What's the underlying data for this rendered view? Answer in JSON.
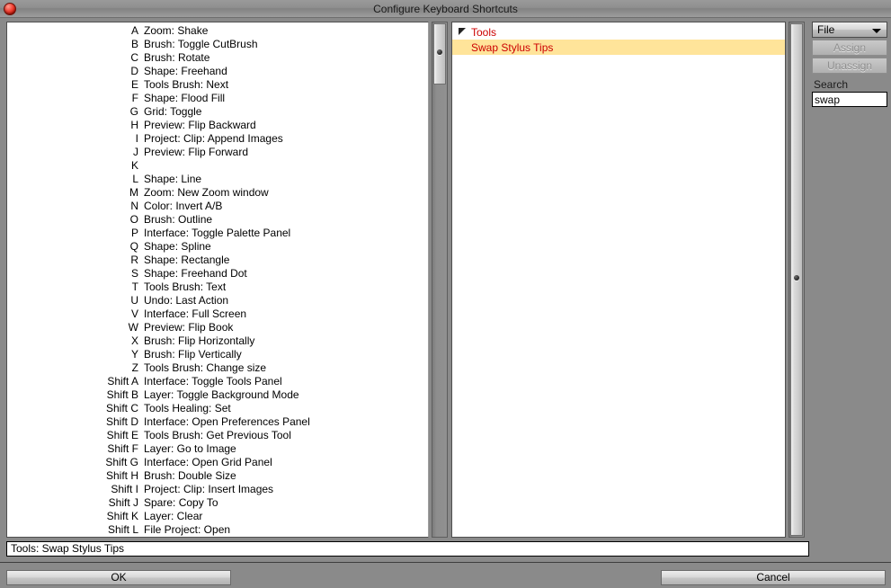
{
  "window": {
    "title": "Configure Keyboard Shortcuts",
    "close_icon": "close-icon"
  },
  "shortcut_list": [
    {
      "key": "A",
      "desc": "Zoom: Shake"
    },
    {
      "key": "B",
      "desc": "Brush: Toggle CutBrush"
    },
    {
      "key": "C",
      "desc": "Brush: Rotate"
    },
    {
      "key": "D",
      "desc": "Shape: Freehand"
    },
    {
      "key": "E",
      "desc": "Tools Brush: Next"
    },
    {
      "key": "F",
      "desc": "Shape: Flood Fill"
    },
    {
      "key": "G",
      "desc": "Grid: Toggle"
    },
    {
      "key": "H",
      "desc": "Preview: Flip Backward"
    },
    {
      "key": "I",
      "desc": "Project: Clip: Append Images"
    },
    {
      "key": "J",
      "desc": "Preview: Flip Forward"
    },
    {
      "key": "K",
      "desc": ""
    },
    {
      "key": "L",
      "desc": "Shape: Line"
    },
    {
      "key": "M",
      "desc": "Zoom: New Zoom window"
    },
    {
      "key": "N",
      "desc": "Color: Invert A/B"
    },
    {
      "key": "O",
      "desc": "Brush: Outline"
    },
    {
      "key": "P",
      "desc": "Interface: Toggle Palette Panel"
    },
    {
      "key": "Q",
      "desc": "Shape: Spline"
    },
    {
      "key": "R",
      "desc": "Shape: Rectangle"
    },
    {
      "key": "S",
      "desc": "Shape: Freehand Dot"
    },
    {
      "key": "T",
      "desc": "Tools Brush: Text"
    },
    {
      "key": "U",
      "desc": "Undo: Last Action"
    },
    {
      "key": "V",
      "desc": "Interface: Full Screen"
    },
    {
      "key": "W",
      "desc": "Preview: Flip Book"
    },
    {
      "key": "X",
      "desc": "Brush: Flip Horizontally"
    },
    {
      "key": "Y",
      "desc": "Brush: Flip Vertically"
    },
    {
      "key": "Z",
      "desc": "Tools Brush: Change size"
    },
    {
      "key": "Shift A",
      "desc": "Interface: Toggle Tools Panel"
    },
    {
      "key": "Shift B",
      "desc": "Layer: Toggle Background Mode"
    },
    {
      "key": "Shift C",
      "desc": "Tools Healing: Set"
    },
    {
      "key": "Shift D",
      "desc": "Interface: Open Preferences Panel"
    },
    {
      "key": "Shift E",
      "desc": "Tools Brush: Get Previous Tool"
    },
    {
      "key": "Shift F",
      "desc": "Layer: Go to Image"
    },
    {
      "key": "Shift G",
      "desc": "Interface: Open Grid Panel"
    },
    {
      "key": "Shift H",
      "desc": "Brush: Double Size"
    },
    {
      "key": "Shift I",
      "desc": "Project: Clip: Insert Images"
    },
    {
      "key": "Shift J",
      "desc": "Spare: Copy To"
    },
    {
      "key": "Shift K",
      "desc": "Layer: Clear"
    },
    {
      "key": "Shift L",
      "desc": "File Project: Open"
    }
  ],
  "tree": {
    "group_label": "Tools",
    "twisty_icon": "triangle-expanded-icon",
    "items": [
      {
        "label": "Swap Stylus Tips",
        "selected": true
      }
    ]
  },
  "controls": {
    "category_dropdown": {
      "value": "File",
      "arrow_icon": "chevron-down-icon"
    },
    "assign_label": "Assign",
    "unassign_label": "Unassign",
    "search_label": "Search",
    "search_value": "swap",
    "search_placeholder": ""
  },
  "status": {
    "value": "Tools: Swap Stylus Tips"
  },
  "buttons": {
    "ok_label": "OK",
    "cancel_label": "Cancel"
  },
  "colors": {
    "highlight": "#ffe49a",
    "tree_text": "#cc0000",
    "window_chrome": "#8a8a8a"
  }
}
